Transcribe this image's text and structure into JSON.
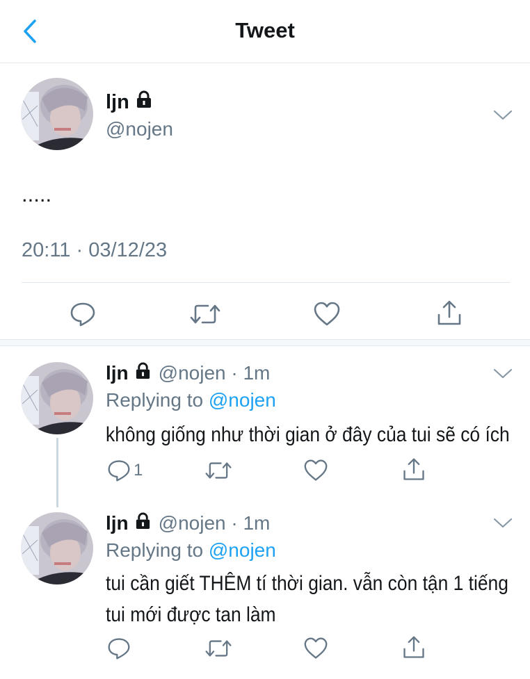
{
  "header": {
    "title": "Tweet",
    "back_icon": "chevron-left-icon"
  },
  "colors": {
    "accent": "#1da1f2",
    "secondary_text": "#657786",
    "divider": "#e1e8ed"
  },
  "main_tweet": {
    "name": "ljn",
    "handle": "@nojen",
    "text": ".....",
    "timestamp": "20:11 · 03/12/23"
  },
  "actions": {
    "reply": "reply-icon",
    "retweet": "retweet-icon",
    "like": "heart-icon",
    "share": "share-icon"
  },
  "replies": [
    {
      "name": "ljn",
      "handle_time": "@nojen · 1m",
      "replying_prefix": "Replying to ",
      "replying_mention": "@nojen",
      "text_lines": [
        "không giống như thời gian ở đây của tui sẽ có ích"
      ],
      "reply_count": "1"
    },
    {
      "name": "ljn",
      "handle_time": "@nojen · 1m",
      "replying_prefix": "Replying to ",
      "replying_mention": "@nojen",
      "text_lines": [
        "tui cần giết THÊM tí thời gian. vẫn còn tận 1 tiếng",
        "tui mới được tan làm"
      ],
      "reply_count": ""
    }
  ]
}
